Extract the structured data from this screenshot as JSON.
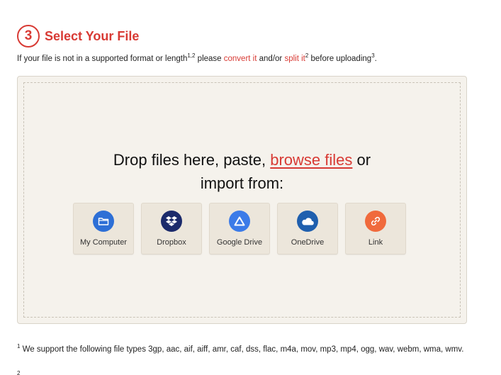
{
  "step": {
    "number": "3",
    "title": "Select Your File"
  },
  "intro": {
    "prefix": "If your file is not in a supported format or length",
    "sup1": "1,2",
    "mid1": " please ",
    "convert_link": "convert it",
    "mid2": " and/or ",
    "split_link": "split it",
    "sup2": "2",
    "mid3": " before uploading",
    "sup3": "3",
    "suffix": "."
  },
  "dropzone": {
    "line1_prefix": "Drop files here, paste, ",
    "browse_link": "browse files",
    "line1_suffix": " or",
    "line2": "import from:"
  },
  "sources": [
    {
      "label": "My Computer",
      "icon": "folder-icon",
      "color": "#2d6fd6"
    },
    {
      "label": "Dropbox",
      "icon": "dropbox-icon",
      "color": "#1b2a6b"
    },
    {
      "label": "Google Drive",
      "icon": "google-drive-icon",
      "color": "#3b7be8"
    },
    {
      "label": "OneDrive",
      "icon": "onedrive-icon",
      "color": "#1f5fae"
    },
    {
      "label": "Link",
      "icon": "link-icon",
      "color": "#f06a3c"
    }
  ],
  "footnotes": {
    "f1_num": "1",
    "f1_text": " We support the following file types 3gp, aac, aif, aiff, amr, caf, dss, flac, m4a, mov, mp3, mp4, ogg, wav, webm, wma, wmv.",
    "f2_num": "2"
  },
  "colors": {
    "accent": "#d83a34",
    "dropzone_bg": "#f5f2ec",
    "button_bg": "#ece6db"
  }
}
